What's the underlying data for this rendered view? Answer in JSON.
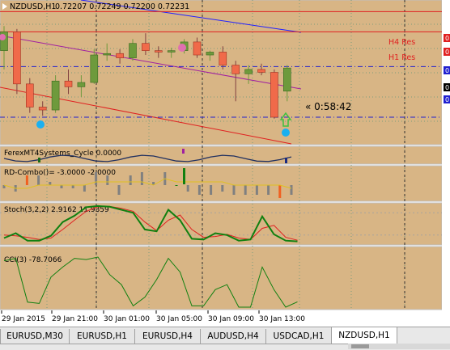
{
  "header": {
    "symbol_timeframe": "NZDUSD,H1",
    "ohlc": "0.72207 0.72249 0.72200 0.72231"
  },
  "main_levels": {
    "h4_res": "H4 Res",
    "h1_res": "H1 Res",
    "countdown": "« 0:58:42"
  },
  "colors": {
    "background": "#d8b585",
    "panel_bg": "#d8b585",
    "grid": "#7a9a7a",
    "bull_candle": "#6e9a3c",
    "bear_candle": "#f06a4a",
    "resistance": "#e02020",
    "bid_line": "#2020d0",
    "trend_blue": "#2020ff",
    "trend_purple": "#a020a0",
    "trend_red": "#e02020",
    "dot_cyan": "#1ab0f0",
    "dot_pink": "#e070b0",
    "stoch_main": "#108010",
    "stoch_signal": "#e02020",
    "cci": "#108010",
    "rd_yellow": "#e0c020"
  },
  "indicators": {
    "cycle": "FerexMT4Systems_Cycle 0.0000",
    "rd_combo": "RD-Combo()= -3.0000 -2.0000",
    "stoch": "Stoch(3,2,2) 2.9162 11.9359",
    "cci": "CCI(3) -78.7066"
  },
  "time_axis": [
    "29 Jan 2015",
    "29 Jan 21:00",
    "30 Jan 01:00",
    "30 Jan 05:00",
    "30 Jan 09:00",
    "30 Jan 13:00"
  ],
  "price_axis_labels": [
    "0",
    "0",
    "0",
    "0",
    "0"
  ],
  "tabs": [
    "EURUSD,M30",
    "EURUSD,H1",
    "EURUSD,H4",
    "AUDUSD,H4",
    "USDCAD,H1",
    "NZDUSD,H1"
  ],
  "active_tab": "NZDUSD,H1",
  "chart_data": {
    "type": "candlestick",
    "candles": [
      {
        "o": 0.7235,
        "h": 0.7252,
        "l": 0.7222,
        "c": 0.7248
      },
      {
        "o": 0.7248,
        "h": 0.725,
        "l": 0.7205,
        "c": 0.7212
      },
      {
        "o": 0.7212,
        "h": 0.7216,
        "l": 0.7192,
        "c": 0.7196
      },
      {
        "o": 0.7196,
        "h": 0.72,
        "l": 0.719,
        "c": 0.7194
      },
      {
        "o": 0.7194,
        "h": 0.7218,
        "l": 0.7192,
        "c": 0.7214
      },
      {
        "o": 0.7214,
        "h": 0.7222,
        "l": 0.7205,
        "c": 0.721
      },
      {
        "o": 0.721,
        "h": 0.7218,
        "l": 0.7203,
        "c": 0.7213
      },
      {
        "o": 0.7213,
        "h": 0.7236,
        "l": 0.7212,
        "c": 0.7232
      },
      {
        "o": 0.7232,
        "h": 0.724,
        "l": 0.7228,
        "c": 0.7233
      },
      {
        "o": 0.7233,
        "h": 0.7236,
        "l": 0.7226,
        "c": 0.723
      },
      {
        "o": 0.723,
        "h": 0.7243,
        "l": 0.7228,
        "c": 0.724
      },
      {
        "o": 0.724,
        "h": 0.7247,
        "l": 0.7232,
        "c": 0.7235
      },
      {
        "o": 0.7235,
        "h": 0.7238,
        "l": 0.723,
        "c": 0.7234
      },
      {
        "o": 0.7234,
        "h": 0.7237,
        "l": 0.723,
        "c": 0.7235
      },
      {
        "o": 0.7235,
        "h": 0.7243,
        "l": 0.7233,
        "c": 0.7241
      },
      {
        "o": 0.7241,
        "h": 0.7244,
        "l": 0.723,
        "c": 0.7232
      },
      {
        "o": 0.7232,
        "h": 0.7235,
        "l": 0.7228,
        "c": 0.7234
      },
      {
        "o": 0.7234,
        "h": 0.7238,
        "l": 0.7222,
        "c": 0.7225
      },
      {
        "o": 0.7225,
        "h": 0.7228,
        "l": 0.72,
        "c": 0.7219
      },
      {
        "o": 0.7219,
        "h": 0.7225,
        "l": 0.7212,
        "c": 0.7222
      },
      {
        "o": 0.7222,
        "h": 0.7226,
        "l": 0.7218,
        "c": 0.722
      },
      {
        "o": 0.722,
        "h": 0.7222,
        "l": 0.7188,
        "c": 0.7189
      },
      {
        "o": 0.7207,
        "h": 0.7225,
        "l": 0.72,
        "c": 0.7223
      }
    ],
    "resistance": {
      "h4": 0.7262,
      "h1": 0.7248
    },
    "bid_lines": [
      0.7224,
      0.7189
    ],
    "stoch_main": [
      12,
      25,
      5,
      5,
      18,
      55,
      72,
      95,
      98,
      96,
      88,
      80,
      35,
      30,
      88,
      60,
      10,
      8,
      25,
      20,
      5,
      8,
      70,
      22,
      5,
      3
    ],
    "stoch_signal": [
      20,
      18,
      14,
      8,
      12,
      35,
      60,
      84,
      96,
      97,
      92,
      84,
      55,
      32,
      60,
      74,
      35,
      14,
      16,
      22,
      12,
      8,
      38,
      46,
      14,
      6
    ],
    "cci": [
      85,
      95,
      -80,
      -85,
      20,
      60,
      95,
      90,
      100,
      30,
      -10,
      -95,
      -60,
      10,
      95,
      40,
      -95,
      -95,
      -30,
      -10,
      -100,
      -100,
      60,
      -30,
      -100,
      -78.7
    ],
    "rd_bars": [
      -1,
      -2,
      3,
      3,
      1,
      -1,
      -1,
      -2,
      4,
      3,
      -3,
      3,
      4,
      1,
      4,
      0,
      -2,
      -3,
      -3,
      -2,
      -3,
      -3,
      -3,
      -3,
      -4,
      -3
    ],
    "rd_line": [
      0,
      -1,
      -1,
      0,
      0,
      0,
      0,
      0,
      1,
      1,
      1,
      1,
      1,
      0,
      2,
      1,
      1,
      1,
      1,
      1,
      0,
      0,
      0,
      0,
      0,
      -1
    ]
  }
}
